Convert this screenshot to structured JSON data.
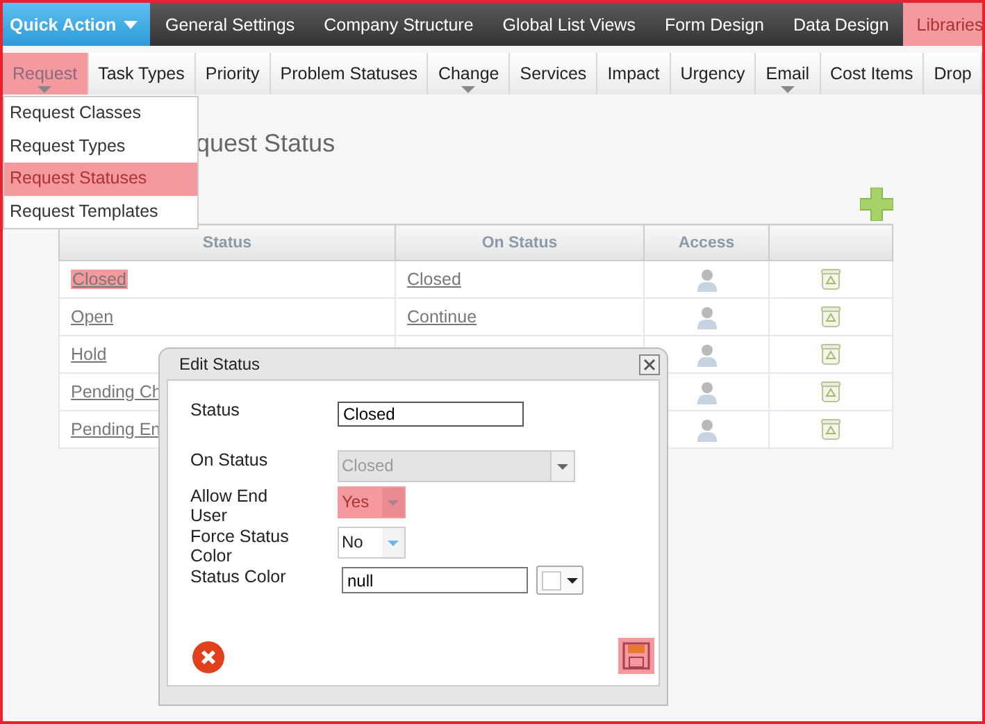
{
  "top_nav": {
    "quick_action": "Quick Action",
    "tabs": [
      {
        "label": "General Settings",
        "selected": false
      },
      {
        "label": "Company Structure",
        "selected": false
      },
      {
        "label": "Global List Views",
        "selected": false
      },
      {
        "label": "Form Design",
        "selected": false
      },
      {
        "label": "Data Design",
        "selected": false
      },
      {
        "label": "Libraries",
        "selected": true
      }
    ]
  },
  "sub_nav": {
    "tabs": [
      {
        "label": "Request",
        "selected": true,
        "has_menu": true
      },
      {
        "label": "Task Types",
        "selected": false,
        "has_menu": false
      },
      {
        "label": "Priority",
        "selected": false,
        "has_menu": false
      },
      {
        "label": "Problem Statuses",
        "selected": false,
        "has_menu": false
      },
      {
        "label": "Change",
        "selected": false,
        "has_menu": true
      },
      {
        "label": "Services",
        "selected": false,
        "has_menu": false
      },
      {
        "label": "Impact",
        "selected": false,
        "has_menu": false
      },
      {
        "label": "Urgency",
        "selected": false,
        "has_menu": false
      },
      {
        "label": "Email",
        "selected": false,
        "has_menu": true
      },
      {
        "label": "Cost Items",
        "selected": false,
        "has_menu": false
      },
      {
        "label": "Drop",
        "selected": false,
        "has_menu": false
      }
    ]
  },
  "menu": {
    "items": [
      {
        "label": "Request Classes",
        "selected": false
      },
      {
        "label": "Request Types",
        "selected": false
      },
      {
        "label": "Request Statuses",
        "selected": true
      },
      {
        "label": "Request Templates",
        "selected": false
      }
    ]
  },
  "page_title": "quest Status",
  "table": {
    "columns": [
      "Status",
      "On Status",
      "Access"
    ],
    "rows": [
      {
        "status": "Closed",
        "on_status": "Closed",
        "selected": true
      },
      {
        "status": "Open",
        "on_status": "Continue",
        "selected": false
      },
      {
        "status": "Hold",
        "selected": false
      },
      {
        "status": "Pending Ch",
        "selected": false
      },
      {
        "status": "Pending En",
        "selected": false
      }
    ]
  },
  "dialog": {
    "title": "Edit Status",
    "save_highlighted": true,
    "fields": [
      {
        "kind": "text",
        "label": "Status",
        "value": "Closed",
        "disabled": false,
        "highlighted": false
      },
      {
        "kind": "combo",
        "label": "On Status",
        "value": "Closed",
        "disabled": true,
        "highlighted": false
      },
      {
        "kind": "select",
        "label": "Allow End User",
        "value": "Yes",
        "disabled": false,
        "highlighted": true
      },
      {
        "kind": "select",
        "label": "Force Status Color",
        "value": "No",
        "disabled": false,
        "highlighted": false
      },
      {
        "kind": "color",
        "label": "Status Color",
        "value": "null",
        "disabled": false,
        "highlighted": false
      }
    ]
  }
}
